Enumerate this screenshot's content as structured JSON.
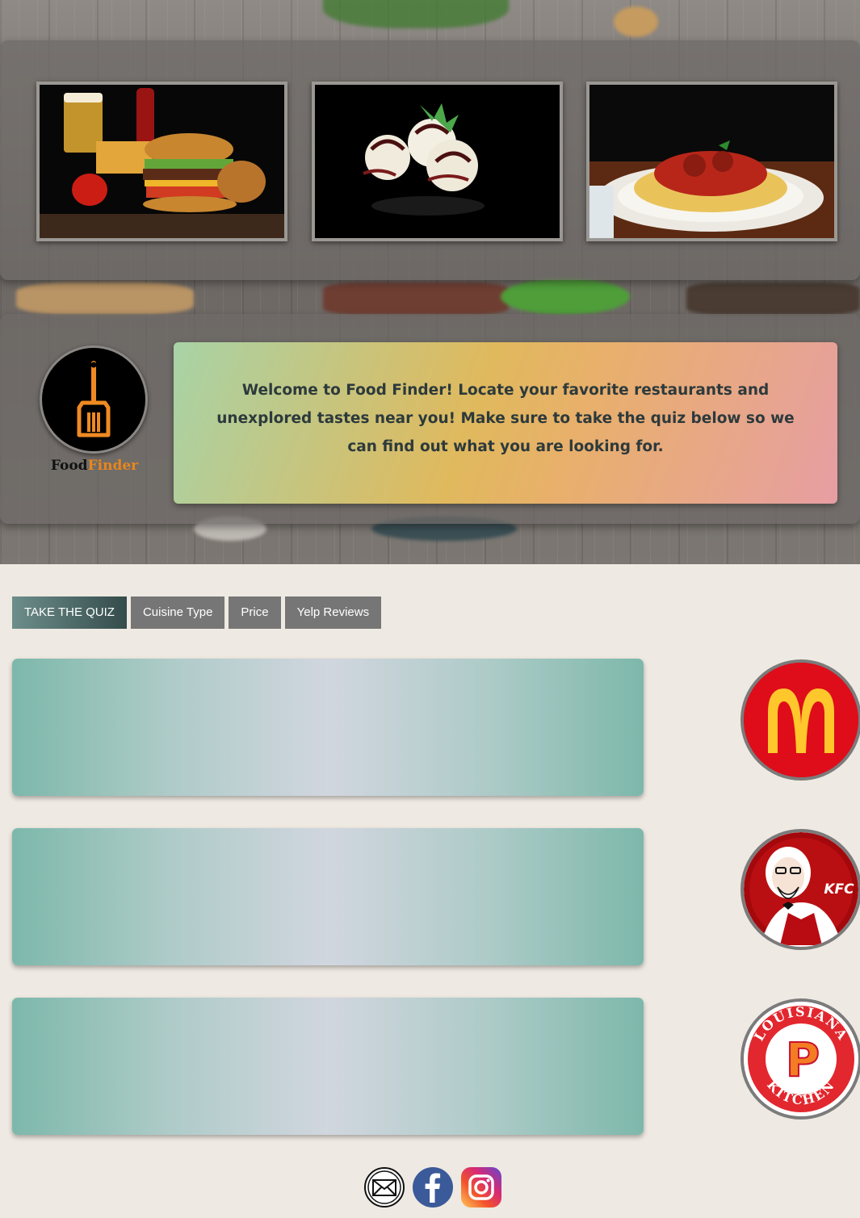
{
  "hero": {
    "gallery": [
      {
        "name": "burger-photo"
      },
      {
        "name": "ice-cream-photo"
      },
      {
        "name": "spaghetti-photo"
      }
    ]
  },
  "logo": {
    "word1": "Food",
    "word2": "Finder"
  },
  "welcome_text": "Welcome to Food Finder! Locate your favorite restaurants and unexplored tastes near you! Make sure to take the quiz below so we can find out what you are looking for.",
  "tabs": [
    {
      "label": "TAKE THE QUIZ",
      "active": true
    },
    {
      "label": "Cuisine Type",
      "active": false
    },
    {
      "label": "Price",
      "active": false
    },
    {
      "label": "Yelp Reviews",
      "active": false
    }
  ],
  "restaurants": [
    {
      "logo": "mcdonalds-logo"
    },
    {
      "logo": "kfc-logo",
      "text": "KFC"
    },
    {
      "logo": "popeyes-logo",
      "text": "LOUISIANA KITCHEN",
      "letter": "P"
    }
  ],
  "social": [
    "mail-icon",
    "facebook-icon",
    "instagram-icon"
  ],
  "colors": {
    "accent_orange": "#e8861c",
    "tab_gray": "#767676",
    "tab_active": "#344c4b",
    "mcd_red": "#df0c1a",
    "mcd_yellow": "#ffc72c",
    "kfc_red": "#a3080c"
  }
}
